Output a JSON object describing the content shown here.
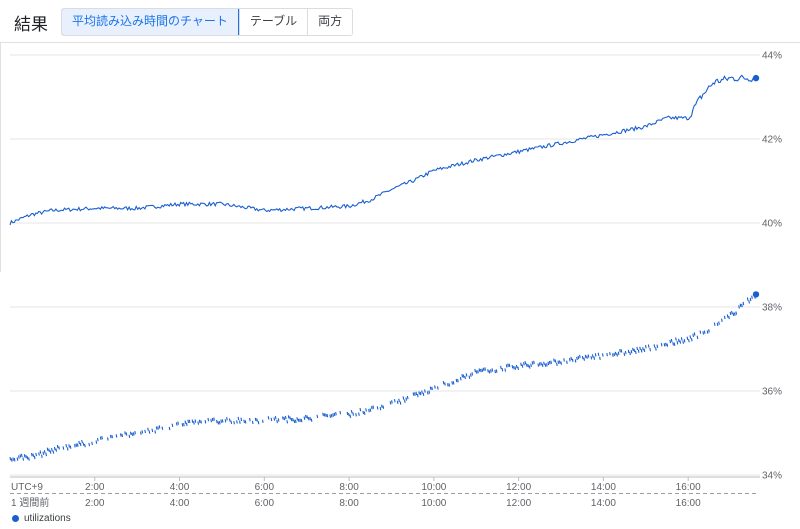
{
  "header": {
    "title": "結果",
    "tabs": [
      {
        "label": "平均読み込み時間のチャート",
        "active": true
      },
      {
        "label": "テーブル",
        "active": false
      },
      {
        "label": "両方",
        "active": false
      }
    ]
  },
  "colors": {
    "series": "#1a5fd0",
    "accent": "#1a73e8",
    "grid": "#e6e6e6"
  },
  "chart_data": [
    {
      "type": "line",
      "x_labels": [
        "UTC+9",
        "2:00",
        "4:00",
        "6:00",
        "8:00",
        "10:00",
        "12:00",
        "14:00",
        "16:00"
      ],
      "x_hours": [
        0,
        2,
        4,
        6,
        8,
        10,
        12,
        14,
        16
      ],
      "x_range_hours": [
        0,
        17.6
      ],
      "ylim": [
        40,
        44
      ],
      "yticks": [
        "40%",
        "42%",
        "44%"
      ],
      "ytick_values": [
        40,
        42,
        44
      ],
      "series": [
        {
          "anchors_x_hours": [
            0,
            0.5,
            1,
            2,
            3,
            4,
            5,
            6,
            7,
            8,
            8.5,
            9,
            9.5,
            10,
            11,
            12,
            13,
            14,
            15,
            15.5,
            16,
            16.3,
            16.6,
            17,
            17.6
          ],
          "anchors_y": [
            40.0,
            40.2,
            40.3,
            40.35,
            40.35,
            40.45,
            40.45,
            40.3,
            40.35,
            40.4,
            40.55,
            40.8,
            41.0,
            41.25,
            41.5,
            41.7,
            41.9,
            42.1,
            42.3,
            42.5,
            42.5,
            43.0,
            43.35,
            43.45,
            43.45
          ]
        }
      ]
    },
    {
      "type": "scatter",
      "x_labels": [
        "1 週間前",
        "2:00",
        "4:00",
        "6:00",
        "8:00",
        "10:00",
        "12:00",
        "14:00",
        "16:00"
      ],
      "x_hours": [
        0,
        2,
        4,
        6,
        8,
        10,
        12,
        14,
        16
      ],
      "x_range_hours": [
        0,
        17.6
      ],
      "ylim": [
        34,
        38
      ],
      "yticks": [
        "34%",
        "36%",
        "38%"
      ],
      "ytick_values": [
        34,
        36,
        38
      ],
      "series": [
        {
          "name": "utilizations",
          "anchors_x_hours": [
            0,
            0.6,
            1,
            2,
            3,
            4,
            5,
            6,
            7,
            8,
            8.7,
            9.3,
            10,
            11,
            12,
            13,
            14,
            15,
            16,
            16.5,
            17,
            17.6
          ],
          "anchors_y": [
            34.4,
            34.45,
            34.6,
            34.8,
            35.0,
            35.2,
            35.3,
            35.3,
            35.35,
            35.45,
            35.6,
            35.8,
            36.05,
            36.45,
            36.6,
            36.7,
            36.85,
            37.0,
            37.25,
            37.45,
            37.8,
            38.3
          ]
        }
      ]
    }
  ],
  "legend": {
    "label": "utilizations"
  }
}
